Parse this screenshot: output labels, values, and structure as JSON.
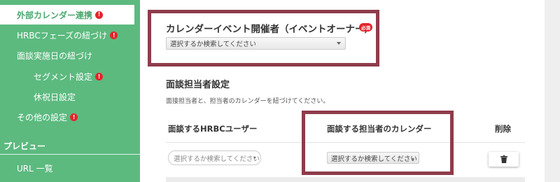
{
  "sidebar": {
    "active_item": "外部カレンダー連携",
    "items": [
      {
        "label": "HRBCフェーズの紐づけ",
        "alert": "!"
      },
      {
        "label": "面談実施日の紐づけ"
      },
      {
        "label": "セグメント設定",
        "alert": "!"
      },
      {
        "label": "休祝日設定"
      },
      {
        "label": "その他の設定",
        "alert": "!"
      }
    ],
    "active_alert": "!",
    "preview_heading": "プレビュー",
    "url_list": "URL 一覧"
  },
  "owner": {
    "title": "カレンダーイベント開催者（イベントオーナー）",
    "required_badge": "必須",
    "select_value": "選択するか検索してください"
  },
  "interviewer": {
    "title": "面談担当者設定",
    "description": "面接担当者と、担当者のカレンダーを紐づけてください。",
    "columns": {
      "user": "面談するHRBCユーザー",
      "calendar": "面談する担当者のカレンダー",
      "delete": "削除"
    },
    "row": {
      "user_placeholder": "選択するか検索してください",
      "calendar_value": "選択するか検索してください"
    }
  },
  "colors": {
    "sidebar": "#5cba7f",
    "highlight": "#8e3c4b",
    "alert": "#e5242b"
  }
}
